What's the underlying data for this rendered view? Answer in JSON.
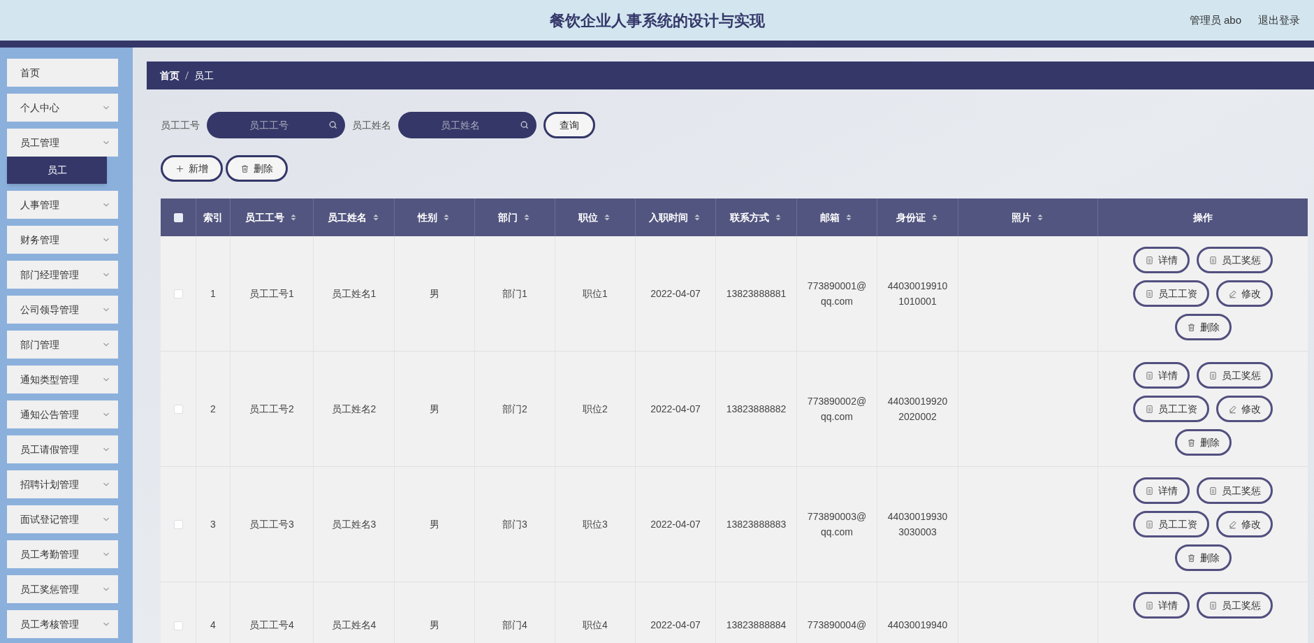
{
  "header": {
    "title": "餐饮企业人事系统的设计与实现",
    "user": "管理员 abo",
    "logout": "退出登录"
  },
  "sidebar": {
    "items": [
      {
        "label": "首页",
        "expandable": false
      },
      {
        "label": "个人中心",
        "expandable": true
      },
      {
        "label": "员工管理",
        "expandable": true,
        "expanded": true,
        "children": [
          {
            "label": "员工",
            "selected": true
          }
        ]
      },
      {
        "label": "人事管理",
        "expandable": true
      },
      {
        "label": "财务管理",
        "expandable": true
      },
      {
        "label": "部门经理管理",
        "expandable": true
      },
      {
        "label": "公司领导管理",
        "expandable": true
      },
      {
        "label": "部门管理",
        "expandable": true
      },
      {
        "label": "通知类型管理",
        "expandable": true
      },
      {
        "label": "通知公告管理",
        "expandable": true
      },
      {
        "label": "员工请假管理",
        "expandable": true
      },
      {
        "label": "招聘计划管理",
        "expandable": true
      },
      {
        "label": "面试登记管理",
        "expandable": true
      },
      {
        "label": "员工考勤管理",
        "expandable": true
      },
      {
        "label": "员工奖惩管理",
        "expandable": true
      },
      {
        "label": "员工考核管理",
        "expandable": true
      }
    ]
  },
  "breadcrumb": [
    "首页",
    "员工"
  ],
  "search": {
    "fields": [
      {
        "label": "员工工号",
        "placeholder": "员工工号"
      },
      {
        "label": "员工姓名",
        "placeholder": "员工姓名"
      }
    ],
    "button": "查询"
  },
  "toolbar": [
    {
      "kind": "add",
      "label": "新增"
    },
    {
      "kind": "delete",
      "label": "删除"
    }
  ],
  "table": {
    "select_all": {
      "checked": false
    },
    "columns": [
      {
        "label": "索引",
        "sortable": false
      },
      {
        "label": "员工工号",
        "sortable": true
      },
      {
        "label": "员工姓名",
        "sortable": true
      },
      {
        "label": "性别",
        "sortable": true
      },
      {
        "label": "部门",
        "sortable": true
      },
      {
        "label": "职位",
        "sortable": true
      },
      {
        "label": "入职时间",
        "sortable": true
      },
      {
        "label": "联系方式",
        "sortable": true
      },
      {
        "label": "邮箱",
        "sortable": true
      },
      {
        "label": "身份证",
        "sortable": true
      },
      {
        "label": "照片",
        "sortable": true
      },
      {
        "label": "操作",
        "sortable": false
      }
    ],
    "rows": [
      {
        "checked": false,
        "cells": [
          "1",
          "员工工号1",
          "员工姓名1",
          "男",
          "部门1",
          "职位1",
          "2022-04-07",
          "13823888881",
          "773890001@qq.com",
          "440300199101010001"
        ],
        "actions": [
          {
            "kind": "doc",
            "label": "详情"
          },
          {
            "kind": "doc",
            "label": "员工奖惩"
          },
          {
            "kind": "doc",
            "label": "员工工资"
          },
          {
            "kind": "edit",
            "label": "修改"
          },
          {
            "kind": "delete",
            "label": "删除"
          }
        ]
      },
      {
        "checked": false,
        "cells": [
          "2",
          "员工工号2",
          "员工姓名2",
          "男",
          "部门2",
          "职位2",
          "2022-04-07",
          "13823888882",
          "773890002@qq.com",
          "440300199202020002"
        ],
        "actions": [
          {
            "kind": "doc",
            "label": "详情"
          },
          {
            "kind": "doc",
            "label": "员工奖惩"
          },
          {
            "kind": "doc",
            "label": "员工工资"
          },
          {
            "kind": "edit",
            "label": "修改"
          },
          {
            "kind": "delete",
            "label": "删除"
          }
        ]
      },
      {
        "checked": false,
        "cells": [
          "3",
          "员工工号3",
          "员工姓名3",
          "男",
          "部门3",
          "职位3",
          "2022-04-07",
          "13823888883",
          "773890003@qq.com",
          "440300199303030003"
        ],
        "actions": [
          {
            "kind": "doc",
            "label": "详情"
          },
          {
            "kind": "doc",
            "label": "员工奖惩"
          },
          {
            "kind": "doc",
            "label": "员工工资"
          },
          {
            "kind": "edit",
            "label": "修改"
          },
          {
            "kind": "delete",
            "label": "删除"
          }
        ]
      },
      {
        "checked": false,
        "cells": [
          "4",
          "员工工号4",
          "员工姓名4",
          "男",
          "部门4",
          "职位4",
          "2022-04-07",
          "13823888884",
          "773890004@",
          "44030019940"
        ],
        "actions": [
          {
            "kind": "doc",
            "label": "详情"
          },
          {
            "kind": "doc",
            "label": "员工奖惩"
          }
        ]
      }
    ]
  }
}
